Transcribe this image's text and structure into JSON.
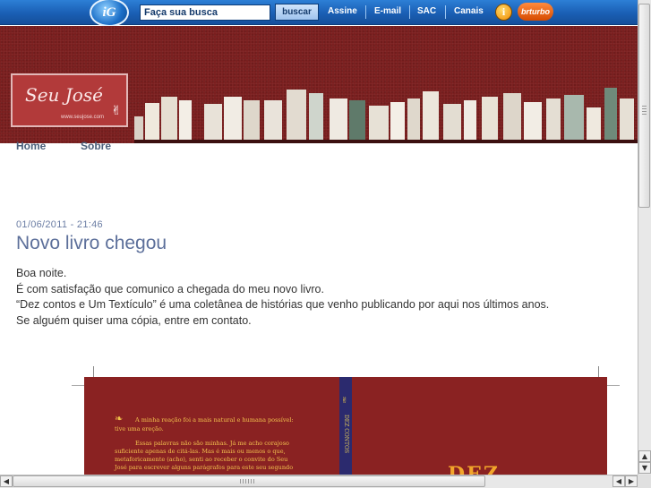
{
  "topbar": {
    "logo": "iG",
    "search_placeholder": "Faça sua busca",
    "search_button": "buscar",
    "links": [
      "Assine",
      "E-mail",
      "SAC",
      "Canais"
    ],
    "info_icon": "i",
    "partner_logo": "brturbo",
    "colors": {
      "bar": "#1a5fb4",
      "text": "#ffffff"
    }
  },
  "header": {
    "logo_text": "Seu José",
    "logo_url": "www.seujose.com",
    "background": "#7a1f1f"
  },
  "nav": {
    "items": [
      "Home",
      "Sobre"
    ]
  },
  "post": {
    "date": "01/06/2011 - 21:46",
    "title": "Novo livro chegou",
    "lines": [
      "Boa noite.",
      "É com satisfação que comunico a chegada do meu novo livro.",
      "“Dez contos e Um Textículo” é uma coletânea de histórias que venho publicando por aqui nos últimos anos.",
      "Se alguém quiser uma cópia, entre em contato."
    ]
  },
  "cover": {
    "lines": [
      "A minha reação foi a mais natural e humana possível:",
      "tive uma ereção.",
      "Essas palavras não são minhas. Já me acho corajoso",
      "suficiente apenas de citá-las. Mas é mais ou menos o que,",
      "metaforicamente (acho), senti ao receber o convite do Seu",
      "José para escrever alguns parágrafos para este seu segundo"
    ],
    "spine_text": "DEZ CONTOS",
    "big_text": "DEZ"
  },
  "scrollbars": {
    "up": "▲",
    "down": "▼",
    "left": "◀",
    "right": "▶"
  }
}
